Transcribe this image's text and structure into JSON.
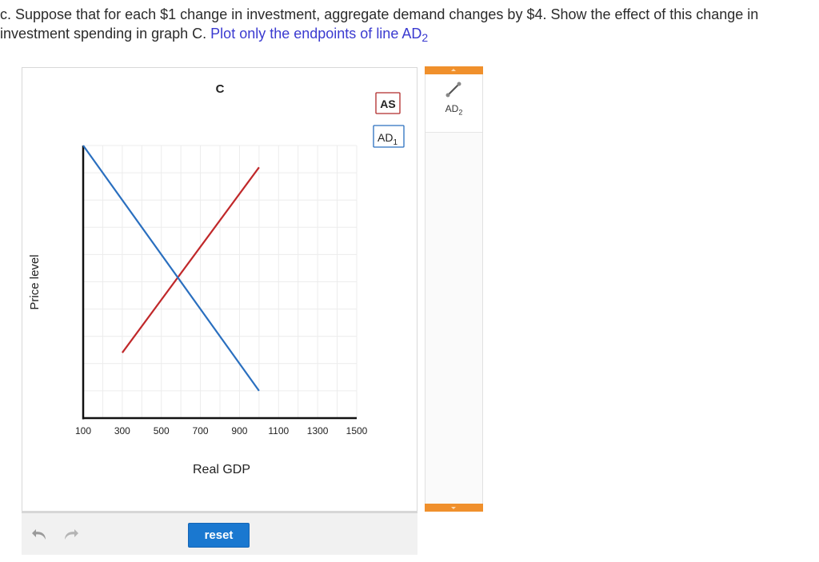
{
  "question": {
    "text_main": "c. Suppose that for each $1 change in investment, aggregate demand changes by $4. Show the effect of this change in investment spending in graph C.",
    "instruction_prefix": "Plot only the endpoints of line AD",
    "instruction_sub": "2"
  },
  "chart_data": {
    "type": "line",
    "title": "C",
    "xlabel": "Real GDP",
    "ylabel": "Price level",
    "x_ticks": [
      100,
      300,
      500,
      700,
      900,
      1100,
      1300,
      1500
    ],
    "xlim": [
      100,
      1500
    ],
    "grid": true,
    "y_tick_labels_shown": false,
    "series": [
      {
        "name": "AS",
        "color": "#c0282a",
        "x": [
          300,
          1000
        ],
        "y": [
          0.24,
          0.92
        ]
      },
      {
        "name": "AD1",
        "color": "#2a6fbf",
        "x": [
          100,
          1000
        ],
        "y": [
          1.0,
          0.1
        ]
      }
    ],
    "legend_labels": {
      "as": "AS",
      "ad_main": "AD",
      "ad_sub": "1"
    }
  },
  "toolbar": {
    "reset_label": "reset",
    "undo_icon": "undo-icon",
    "redo_icon": "redo-icon"
  },
  "tools": {
    "ad2_main": "AD",
    "ad2_sub": "2",
    "icon": "line-tool-icon"
  },
  "colors": {
    "accent_orange": "#f0902c",
    "button_blue": "#1a78d0",
    "instruction_blue": "#3a3ad0"
  }
}
